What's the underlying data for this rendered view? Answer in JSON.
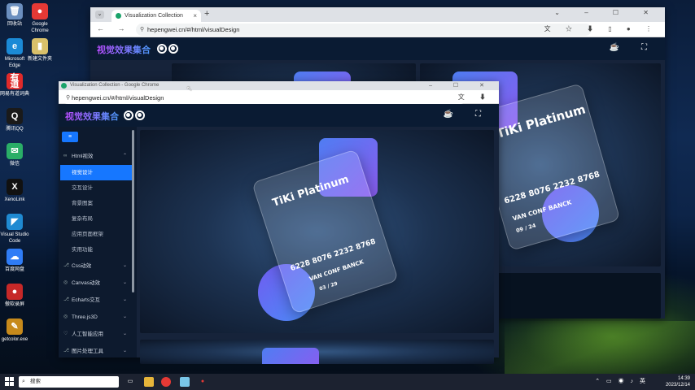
{
  "desktop": {
    "icons": [
      {
        "label": "回收站",
        "glyph": "🗑",
        "color": "#6b8fbf"
      },
      {
        "label": "Google Chrome",
        "glyph": "●",
        "color": "#e53935"
      },
      {
        "label": "Microsoft Edge",
        "glyph": "e",
        "color": "#1b8ad6"
      },
      {
        "label": "新建文件夹",
        "glyph": "▮",
        "color": "#d9c06a"
      },
      {
        "label": "网易有道词典",
        "glyph": "有道",
        "color": "#e02a2a"
      },
      {
        "label": "腾讯QQ",
        "glyph": "Q",
        "color": "#1a1a1a"
      },
      {
        "label": "微信",
        "glyph": "✉",
        "color": "#2aae67"
      },
      {
        "label": "XenoLink",
        "glyph": "X",
        "color": "#111111"
      },
      {
        "label": "Visual Studio Code",
        "glyph": "◤",
        "color": "#1f8ad2"
      },
      {
        "label": "百度网盘",
        "glyph": "☁",
        "color": "#2f7cf6"
      },
      {
        "label": "傲软录屏",
        "glyph": "●",
        "color": "#c62828"
      },
      {
        "label": "getcolor.exe",
        "glyph": "✎",
        "color": "#c78a1b"
      }
    ]
  },
  "back_window": {
    "tab_title": "Visualization Collection",
    "url": "hepengwei.cn/#/html/visualDesign",
    "app_logo": "视觉效果集合",
    "card": {
      "title": "TiKi Platinum",
      "number": "6228 8076 2232 8768",
      "name": "VAN CONF BANCK",
      "date": "09 / 24"
    }
  },
  "front_window": {
    "title": "Visualization Collection - Google Chrome",
    "url": "hepengwei.cn/#/html/visualDesign",
    "app_logo": "视觉效果集合",
    "menu_toggle": "≡",
    "menu": [
      {
        "label": "Html视效",
        "icon": "∞",
        "expanded": true,
        "children": [
          "视觉设计",
          "交互设计",
          "背景图案",
          "复杂布局",
          "应用页面框架",
          "实用功能"
        ]
      },
      {
        "label": "Css动效",
        "icon": "⎇"
      },
      {
        "label": "Canvas动效",
        "icon": "◎"
      },
      {
        "label": "Echarts交互",
        "icon": "⎇"
      },
      {
        "label": "Three.js3D",
        "icon": "◎"
      },
      {
        "label": "人工智能应用",
        "icon": "♡"
      },
      {
        "label": "图片处理工具",
        "icon": "⎇"
      }
    ],
    "active_item": "视觉设计",
    "card": {
      "title": "TiKi Platinum",
      "number": "6228 8076 2232 8768",
      "name": "VAN CONF BANCK",
      "date": "03 / 29"
    }
  },
  "taskbar": {
    "search_placeholder": "搜索",
    "ime": "英",
    "time": "14:39",
    "date": "2023/12/14"
  }
}
